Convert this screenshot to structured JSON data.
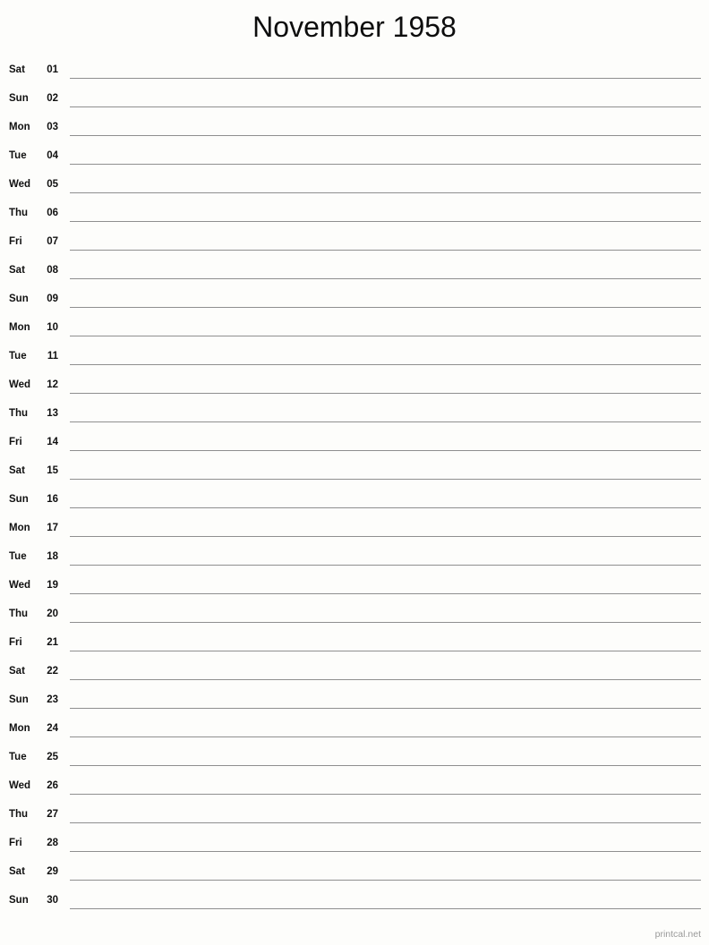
{
  "document": {
    "title": "November 1958",
    "month_name": "November",
    "year": "1958"
  },
  "colors": {
    "background": "#fdfdfb",
    "text": "#111111",
    "rule": "#8f8f8f",
    "footer_text": "#9a9a9a"
  },
  "days": [
    {
      "weekday": "Sat",
      "number": "01"
    },
    {
      "weekday": "Sun",
      "number": "02"
    },
    {
      "weekday": "Mon",
      "number": "03"
    },
    {
      "weekday": "Tue",
      "number": "04"
    },
    {
      "weekday": "Wed",
      "number": "05"
    },
    {
      "weekday": "Thu",
      "number": "06"
    },
    {
      "weekday": "Fri",
      "number": "07"
    },
    {
      "weekday": "Sat",
      "number": "08"
    },
    {
      "weekday": "Sun",
      "number": "09"
    },
    {
      "weekday": "Mon",
      "number": "10"
    },
    {
      "weekday": "Tue",
      "number": "11"
    },
    {
      "weekday": "Wed",
      "number": "12"
    },
    {
      "weekday": "Thu",
      "number": "13"
    },
    {
      "weekday": "Fri",
      "number": "14"
    },
    {
      "weekday": "Sat",
      "number": "15"
    },
    {
      "weekday": "Sun",
      "number": "16"
    },
    {
      "weekday": "Mon",
      "number": "17"
    },
    {
      "weekday": "Tue",
      "number": "18"
    },
    {
      "weekday": "Wed",
      "number": "19"
    },
    {
      "weekday": "Thu",
      "number": "20"
    },
    {
      "weekday": "Fri",
      "number": "21"
    },
    {
      "weekday": "Sat",
      "number": "22"
    },
    {
      "weekday": "Sun",
      "number": "23"
    },
    {
      "weekday": "Mon",
      "number": "24"
    },
    {
      "weekday": "Tue",
      "number": "25"
    },
    {
      "weekday": "Wed",
      "number": "26"
    },
    {
      "weekday": "Thu",
      "number": "27"
    },
    {
      "weekday": "Fri",
      "number": "28"
    },
    {
      "weekday": "Sat",
      "number": "29"
    },
    {
      "weekday": "Sun",
      "number": "30"
    }
  ],
  "footer": {
    "credit": "printcal.net"
  }
}
